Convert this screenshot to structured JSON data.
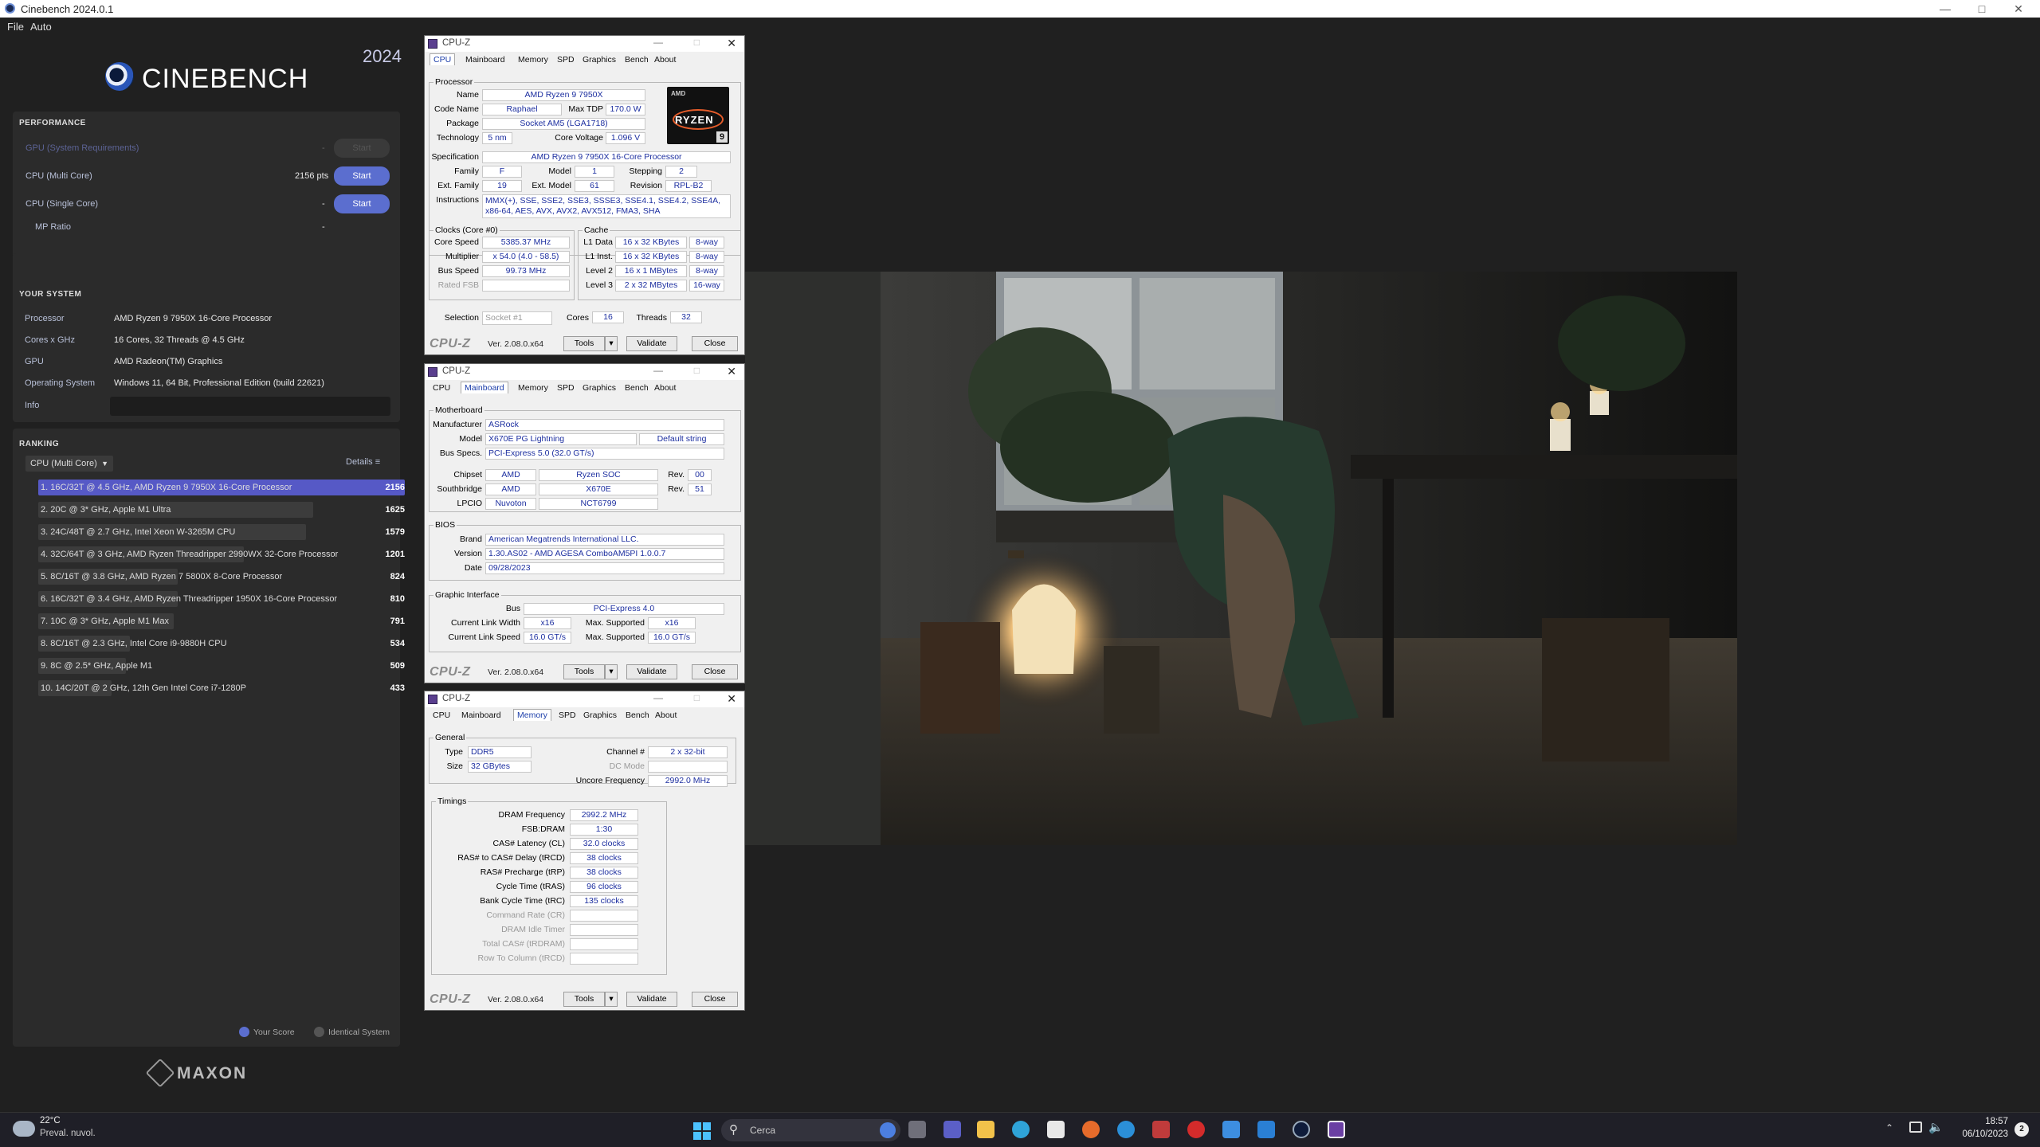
{
  "window": {
    "title": "Cinebench 2024.0.1"
  },
  "menu": [
    "File",
    "Auto"
  ],
  "cinebench": {
    "brand": "CINEBENCH",
    "version_badge": "2024",
    "performance": {
      "heading": "PERFORMANCE",
      "rows": [
        {
          "label": "GPU (System Requirements)",
          "score": "-",
          "button": "Start",
          "disabled": true
        },
        {
          "label": "CPU (Multi Core)",
          "score": "2156 pts",
          "button": "Start",
          "disabled": false
        },
        {
          "label": "CPU (Single Core)",
          "score": "-",
          "button": "Start",
          "disabled": false
        },
        {
          "label": "MP Ratio",
          "score": "-",
          "button": "",
          "disabled": false
        }
      ]
    },
    "system": {
      "heading": "YOUR SYSTEM",
      "rows": [
        {
          "label": "Processor",
          "value": "AMD Ryzen 9 7950X 16-Core Processor"
        },
        {
          "label": "Cores x GHz",
          "value": "16 Cores, 32 Threads @ 4.5 GHz"
        },
        {
          "label": "GPU",
          "value": "AMD Radeon(TM) Graphics"
        },
        {
          "label": "Operating System",
          "value": "Windows 11, 64 Bit, Professional Edition (build 22621)"
        },
        {
          "label": "Info",
          "value": ""
        }
      ]
    },
    "ranking": {
      "heading": "RANKING",
      "dropdown": "CPU (Multi Core)",
      "details": "Details",
      "max_score": 2156,
      "entries": [
        {
          "label": "1. 16C/32T @ 4.5 GHz, AMD Ryzen 9 7950X 16-Core Processor",
          "score": 2156,
          "mine": true
        },
        {
          "label": "2. 20C @ 3* GHz, Apple M1 Ultra",
          "score": 1625
        },
        {
          "label": "3. 24C/48T @ 2.7 GHz, Intel Xeon W-3265M CPU",
          "score": 1579
        },
        {
          "label": "4. 32C/64T @ 3 GHz, AMD Ryzen Threadripper 2990WX 32-Core Processor",
          "score": 1201
        },
        {
          "label": "5. 8C/16T @ 3.8 GHz, AMD Ryzen 7 5800X 8-Core Processor",
          "score": 824
        },
        {
          "label": "6. 16C/32T @ 3.4 GHz, AMD Ryzen Threadripper 1950X 16-Core Processor",
          "score": 810
        },
        {
          "label": "7. 10C @ 3* GHz, Apple M1 Max",
          "score": 791
        },
        {
          "label": "8. 8C/16T @ 2.3 GHz, Intel Core i9-9880H CPU",
          "score": 534
        },
        {
          "label": "9. 8C @ 2.5* GHz, Apple M1",
          "score": 509
        },
        {
          "label": "10. 14C/20T @ 2 GHz, 12th Gen Intel Core i7-1280P",
          "score": 433
        }
      ],
      "legend": {
        "your_score": "Your Score",
        "identical": "Identical System"
      }
    },
    "maxon": "MAXON",
    "colors": {
      "accent": "#5b6ecf",
      "highlight_row": "#5659c6"
    }
  },
  "cpuz_common": {
    "title": "CPU-Z",
    "tabs": [
      "CPU",
      "Mainboard",
      "Memory",
      "SPD",
      "Graphics",
      "Bench",
      "About"
    ],
    "logo": "CPU-Z",
    "version": "Ver. 2.08.0.x64",
    "tools": "Tools",
    "validate": "Validate",
    "close": "Close"
  },
  "cpuz_cpu": {
    "processor_group": "Processor",
    "name": "AMD Ryzen 9 7950X",
    "code_name": "Raphael",
    "max_tdp": "170.0 W",
    "package": "Socket AM5 (LGA1718)",
    "technology": "5 nm",
    "core_voltage": "1.096 V",
    "specification": "AMD Ryzen 9 7950X 16-Core Processor",
    "family": "F",
    "model": "1",
    "stepping": "2",
    "ext_family": "19",
    "ext_model": "61",
    "revision": "RPL-B2",
    "instructions": "MMX(+), SSE, SSE2, SSE3, SSSE3, SSE4.1, SSE4.2, SSE4A, x86-64, AES, AVX, AVX2, AVX512, FMA3, SHA",
    "clocks_group": "Clocks (Core #0)",
    "core_speed": "5385.37 MHz",
    "multiplier": "x 54.0 (4.0 - 58.5)",
    "bus_speed": "99.73 MHz",
    "rated_fsb": "",
    "cache_group": "Cache",
    "l1d": "16 x 32 KBytes",
    "l1d_w": "8-way",
    "l1i": "16 x 32 KBytes",
    "l1i_w": "8-way",
    "l2": "16 x 1 MBytes",
    "l2_w": "8-way",
    "l3": "2 x 32 MBytes",
    "l3_w": "16-way",
    "selection": "Socket #1",
    "cores": "16",
    "threads": "32",
    "labels": {
      "name": "Name",
      "code_name": "Code Name",
      "max_tdp": "Max TDP",
      "package": "Package",
      "technology": "Technology",
      "core_voltage": "Core Voltage",
      "specification": "Specification",
      "family": "Family",
      "model": "Model",
      "stepping": "Stepping",
      "ext_family": "Ext. Family",
      "ext_model": "Ext. Model",
      "revision": "Revision",
      "instructions": "Instructions",
      "core_speed": "Core Speed",
      "multiplier": "Multiplier",
      "bus_speed": "Bus Speed",
      "rated_fsb": "Rated FSB",
      "l1d": "L1 Data",
      "l1i": "L1 Inst.",
      "l2": "Level 2",
      "l3": "Level 3",
      "selection": "Selection",
      "cores": "Cores",
      "threads": "Threads"
    },
    "badge_top": "AMD",
    "badge_mid": "RYZEN",
    "badge_num": "9"
  },
  "cpuz_mb": {
    "motherboard_group": "Motherboard",
    "manufacturer": "ASRock",
    "model": "X670E PG Lightning",
    "model_extra": "Default string",
    "bus_specs": "PCI-Express 5.0 (32.0 GT/s)",
    "chipset_vendor": "AMD",
    "chipset": "Ryzen SOC",
    "chipset_rev": "00",
    "south_vendor": "AMD",
    "south": "X670E",
    "south_rev": "51",
    "lpcio_vendor": "Nuvoton",
    "lpcio": "NCT6799",
    "bios_group": "BIOS",
    "brand": "American Megatrends International LLC.",
    "bios_version": "1.30.AS02 - AMD AGESA ComboAM5PI 1.0.0.7",
    "date": "09/28/2023",
    "gi_group": "Graphic Interface",
    "bus": "PCI-Express 4.0",
    "link_width": "x16",
    "max_width": "x16",
    "link_speed": "16.0 GT/s",
    "max_speed": "16.0 GT/s",
    "labels": {
      "manufacturer": "Manufacturer",
      "model": "Model",
      "bus_specs": "Bus Specs.",
      "chipset": "Chipset",
      "south": "Southbridge",
      "lpcio": "LPCIO",
      "rev": "Rev.",
      "brand": "Brand",
      "version": "Version",
      "date": "Date",
      "bus": "Bus",
      "cur_width": "Current Link Width",
      "max_supported": "Max. Supported",
      "cur_speed": "Current Link Speed"
    }
  },
  "cpuz_mem": {
    "general_group": "General",
    "type": "DDR5",
    "size": "32 GBytes",
    "channel": "2 x 32-bit",
    "dc_mode": "",
    "uncore": "2992.0 MHz",
    "timings_group": "Timings",
    "timings": [
      {
        "label": "DRAM Frequency",
        "value": "2992.2 MHz",
        "dim": false
      },
      {
        "label": "FSB:DRAM",
        "value": "1:30",
        "dim": false
      },
      {
        "label": "CAS# Latency (CL)",
        "value": "32.0 clocks",
        "dim": false
      },
      {
        "label": "RAS# to CAS# Delay (tRCD)",
        "value": "38 clocks",
        "dim": false
      },
      {
        "label": "RAS# Precharge (tRP)",
        "value": "38 clocks",
        "dim": false
      },
      {
        "label": "Cycle Time (tRAS)",
        "value": "96 clocks",
        "dim": false
      },
      {
        "label": "Bank Cycle Time (tRC)",
        "value": "135 clocks",
        "dim": false
      },
      {
        "label": "Command Rate (CR)",
        "value": "",
        "dim": true
      },
      {
        "label": "DRAM Idle Timer",
        "value": "",
        "dim": true
      },
      {
        "label": "Total CAS# (tRDRAM)",
        "value": "",
        "dim": true
      },
      {
        "label": "Row To Column (tRCD)",
        "value": "",
        "dim": true
      }
    ],
    "labels": {
      "type": "Type",
      "size": "Size",
      "channel": "Channel #",
      "dc_mode": "DC Mode",
      "uncore": "Uncore Frequency"
    }
  },
  "taskbar": {
    "temp": "22°C",
    "weather": "Preval. nuvol.",
    "search": "Cerca",
    "time": "18:57",
    "date": "06/10/2023",
    "notif": "2"
  }
}
